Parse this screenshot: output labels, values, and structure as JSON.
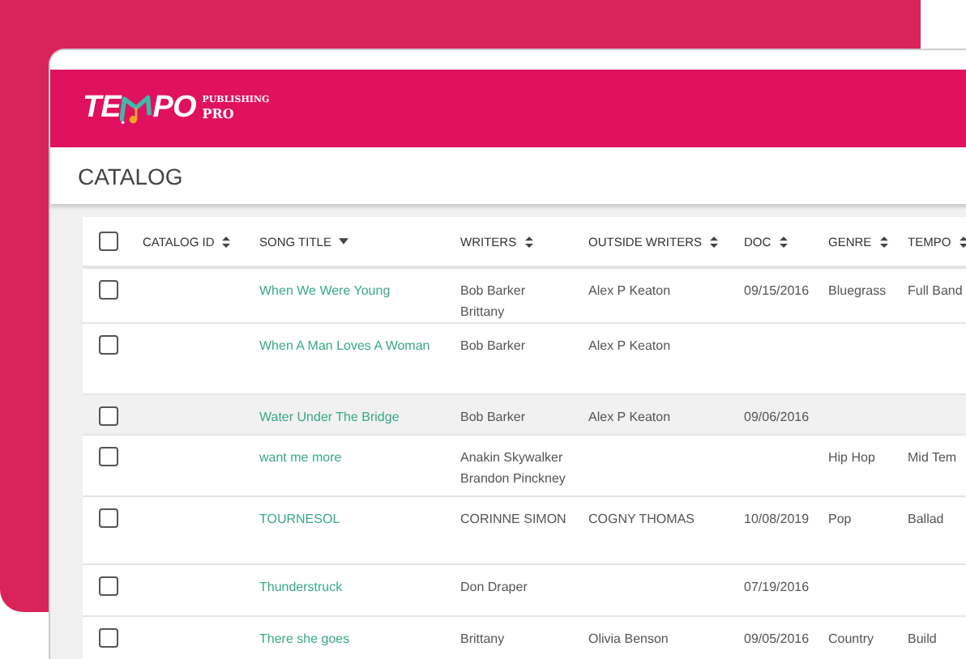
{
  "header": {
    "logo_left": "TE",
    "logo_right": "PO",
    "logo_sub_top": "PUBLISHING",
    "logo_sub_bottom": "PRO"
  },
  "page_title": "CATALOG",
  "table": {
    "select_all": {
      "checked": false
    },
    "columns": [
      {
        "label": "CATALOG ID",
        "sorted_descending": false
      },
      {
        "label": "SONG TITLE",
        "sorted_descending": true
      },
      {
        "label": "WRITERS",
        "sorted_descending": false
      },
      {
        "label": "OUTSIDE WRITERS",
        "sorted_descending": false
      },
      {
        "label": "DOC",
        "sorted_descending": false
      },
      {
        "label": "GENRE",
        "sorted_descending": false
      },
      {
        "label": "TEMPO",
        "sorted_descending": false
      }
    ],
    "rows": [
      {
        "checked": false,
        "highlighted": false,
        "catalog_id": "",
        "song_title": "When We Were Young",
        "writers": [
          "Bob Barker",
          "Brittany"
        ],
        "outside_writers": "Alex P Keaton",
        "doc": "09/15/2016",
        "genre": "Bluegrass",
        "tempo": "Full Band"
      },
      {
        "checked": false,
        "highlighted": false,
        "catalog_id": "",
        "song_title": "When A Man Loves A Woman",
        "writers": [
          "Bob Barker"
        ],
        "outside_writers": "Alex P Keaton",
        "doc": "",
        "genre": "",
        "tempo": ""
      },
      {
        "checked": false,
        "highlighted": true,
        "catalog_id": "",
        "song_title": "Water Under The Bridge",
        "writers": [
          "Bob Barker"
        ],
        "outside_writers": "Alex P Keaton",
        "doc": "09/06/2016",
        "genre": "",
        "tempo": ""
      },
      {
        "checked": false,
        "highlighted": false,
        "catalog_id": "",
        "song_title": "want me more",
        "writers": [
          "Anakin Skywalker",
          "Brandon Pinckney"
        ],
        "outside_writers": "",
        "doc": "",
        "genre": "Hip Hop",
        "tempo": "Mid Tem"
      },
      {
        "checked": false,
        "highlighted": false,
        "catalog_id": "",
        "song_title": "TOURNESOL",
        "writers": [
          "CORINNE SIMON"
        ],
        "outside_writers": "COGNY THOMAS",
        "doc": "10/08/2019",
        "genre": "Pop",
        "tempo": "Ballad"
      },
      {
        "checked": false,
        "highlighted": false,
        "catalog_id": "",
        "song_title": "Thunderstruck",
        "writers": [
          "Don Draper"
        ],
        "outside_writers": "",
        "doc": "07/19/2016",
        "genre": "",
        "tempo": ""
      },
      {
        "checked": false,
        "highlighted": false,
        "catalog_id": "",
        "song_title": "There she goes",
        "writers": [
          "Brittany"
        ],
        "outside_writers": "Olivia Benson",
        "doc": "09/05/2016",
        "genre": "Country",
        "tempo": "Build"
      }
    ]
  }
}
